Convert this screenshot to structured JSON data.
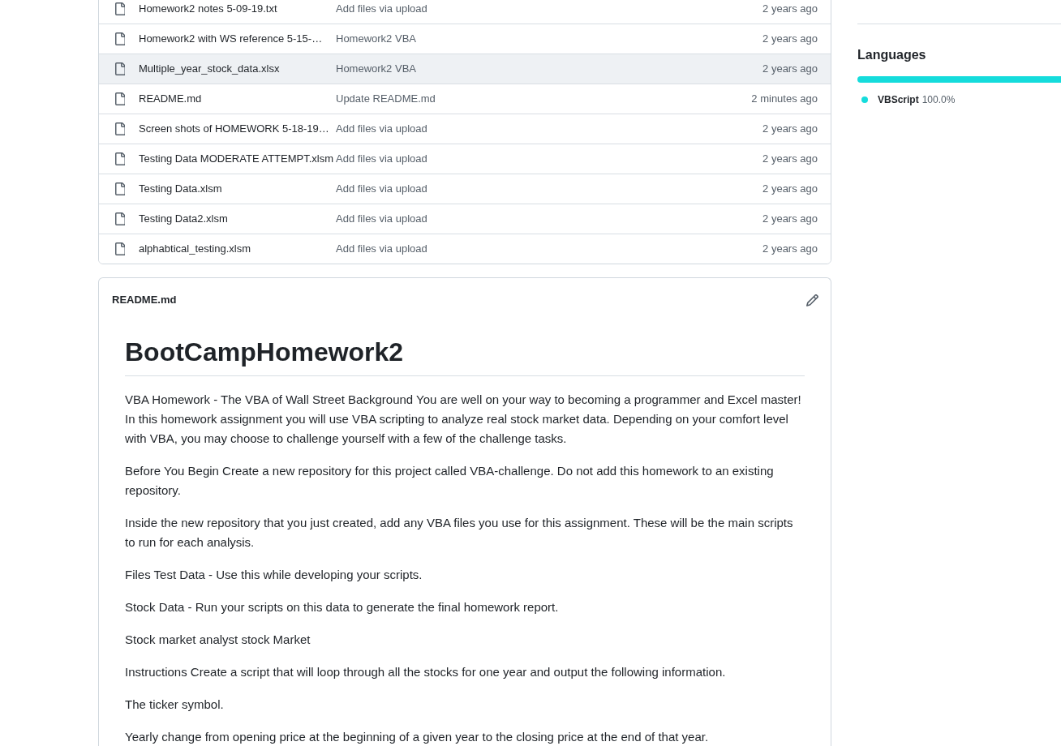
{
  "files": [
    {
      "name": "Homework2 notes 5-09-19.txt",
      "message": "Add files via upload",
      "time": "2 years ago",
      "highlighted": false
    },
    {
      "name": "Homework2 with WS reference 5-15-…",
      "message": "Homework2 VBA",
      "time": "2 years ago",
      "highlighted": false
    },
    {
      "name": "Multiple_year_stock_data.xlsx",
      "message": "Homework2 VBA",
      "time": "2 years ago",
      "highlighted": true
    },
    {
      "name": "README.md",
      "message": "Update README.md",
      "time": "2 minutes ago",
      "highlighted": false
    },
    {
      "name": "Screen shots of HOMEWORK 5-18-19…",
      "message": "Add files via upload",
      "time": "2 years ago",
      "highlighted": false
    },
    {
      "name": "Testing Data MODERATE ATTEMPT.xlsm",
      "message": "Add files via upload",
      "time": "2 years ago",
      "highlighted": false
    },
    {
      "name": "Testing Data.xlsm",
      "message": "Add files via upload",
      "time": "2 years ago",
      "highlighted": false
    },
    {
      "name": "Testing Data2.xlsm",
      "message": "Add files via upload",
      "time": "2 years ago",
      "highlighted": false
    },
    {
      "name": "alphabtical_testing.xlsm",
      "message": "Add files via upload",
      "time": "2 years ago",
      "highlighted": false
    }
  ],
  "readme": {
    "title": "README.md",
    "heading": "BootCampHomework2",
    "paragraphs": [
      "VBA Homework - The VBA of Wall Street Background You are well on your way to becoming a programmer and Excel master! In this homework assignment you will use VBA scripting to analyze real stock market data. Depending on your comfort level with VBA, you may choose to challenge yourself with a few of the challenge tasks.",
      "Before You Begin Create a new repository for this project called VBA-challenge. Do not add this homework to an existing repository.",
      "Inside the new repository that you just created, add any VBA files you use for this assignment. These will be the main scripts to run for each analysis.",
      "Files Test Data - Use this while developing your scripts.",
      "Stock Data - Run your scripts on this data to generate the final homework report.",
      "Stock market analyst stock Market",
      "Instructions Create a script that will loop through all the stocks for one year and output the following information.",
      "The ticker symbol.",
      "Yearly change from opening price at the beginning of a given year to the closing price at the end of that year."
    ]
  },
  "sidebar": {
    "languages": {
      "title": "Languages",
      "items": [
        {
          "name": "VBScript",
          "percent": "100.0%",
          "color": "#15dcdc",
          "level": 1
        }
      ]
    }
  }
}
